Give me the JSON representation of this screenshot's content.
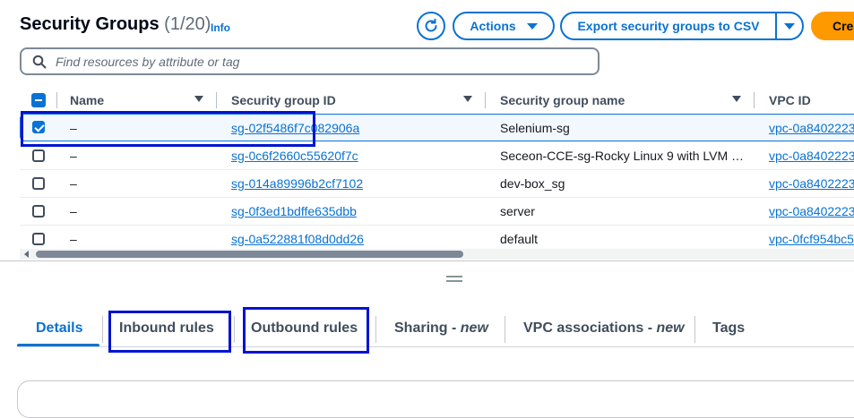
{
  "header": {
    "title": "Security Groups",
    "count": "(1/20)",
    "info_link": "Info",
    "actions_label": "Actions",
    "export_label": "Export security groups to CSV",
    "create_label": "Create"
  },
  "search": {
    "placeholder": "Find resources by attribute or tag"
  },
  "table": {
    "columns": [
      "Name",
      "Security group ID",
      "Security group name",
      "VPC ID"
    ],
    "rows": [
      {
        "selected": true,
        "name": "–",
        "sg_id": "sg-02f5486f7c082906a",
        "sg_name": "Selenium-sg",
        "vpc_id": "vpc-0a8402223"
      },
      {
        "selected": false,
        "name": "–",
        "sg_id": "sg-0c6f2660c55620f7c",
        "sg_name": "Seceon-CCE-sg-Rocky Linux 9 with LVM …",
        "vpc_id": "vpc-0a8402223"
      },
      {
        "selected": false,
        "name": "–",
        "sg_id": "sg-014a89996b2cf7102",
        "sg_name": "dev-box_sg",
        "vpc_id": "vpc-0a8402223"
      },
      {
        "selected": false,
        "name": "–",
        "sg_id": "sg-0f3ed1bdffe635dbb",
        "sg_name": "server",
        "vpc_id": "vpc-0a8402223"
      },
      {
        "selected": false,
        "name": "–",
        "sg_id": "sg-0a522881f08d0dd26",
        "sg_name": "default",
        "vpc_id": "vpc-0fcf954bc5"
      }
    ]
  },
  "tabs": {
    "details": "Details",
    "inbound": "Inbound rules",
    "outbound": "Outbound rules",
    "sharing": "Sharing - ",
    "sharing_new": "new",
    "vpc_assoc": "VPC associations - ",
    "vpc_assoc_new": "new",
    "tags": "Tags"
  },
  "colors": {
    "accent": "#0972d3",
    "primary_button": "#ff9900",
    "highlight_box": "#0013d1"
  },
  "icons": [
    "refresh-icon",
    "caret-down-icon",
    "search-icon",
    "sort-icon",
    "checkbox-icon",
    "resize-handle-icon"
  ]
}
